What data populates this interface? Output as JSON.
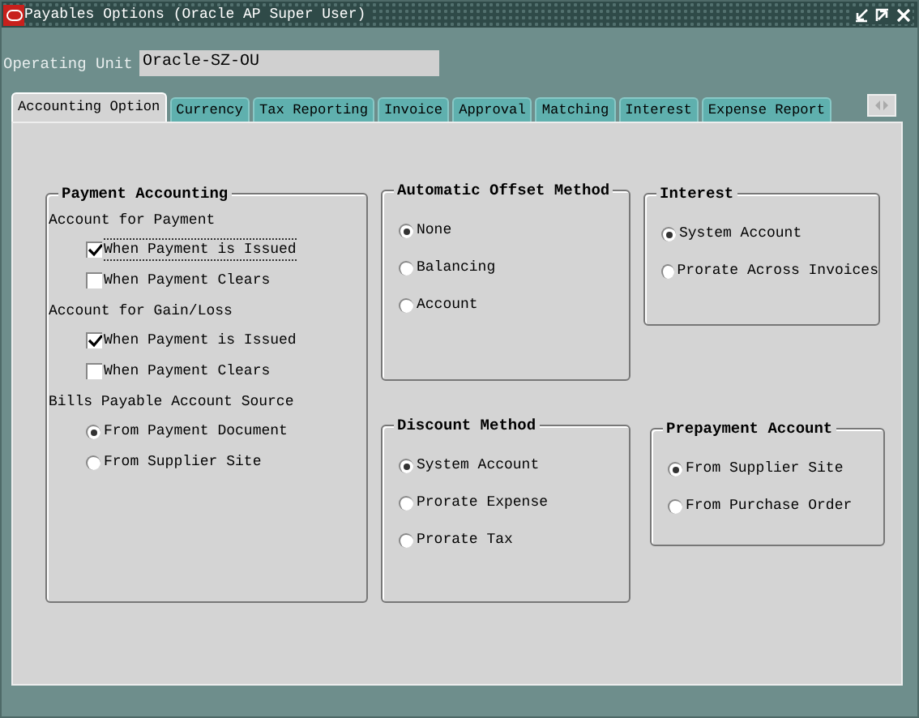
{
  "window": {
    "title": "Payables Options (Oracle AP Super User)"
  },
  "operating_unit": {
    "label": "Operating Unit",
    "value": "Oracle-SZ-OU"
  },
  "tabs": [
    {
      "label": "Accounting Option",
      "selected": true
    },
    {
      "label": "Currency",
      "selected": false
    },
    {
      "label": "Tax Reporting",
      "selected": false
    },
    {
      "label": "Invoice",
      "selected": false
    },
    {
      "label": "Approval",
      "selected": false
    },
    {
      "label": "Matching",
      "selected": false
    },
    {
      "label": "Interest",
      "selected": false
    },
    {
      "label": "Expense Report",
      "selected": false
    }
  ],
  "columns": [
    [
      {
        "title": "Payment Accounting",
        "items": [
          {
            "kind": "label",
            "text": "Account for Payment"
          },
          {
            "kind": "checkbox",
            "text": "When Payment is Issued",
            "checked": true,
            "focused": true
          },
          {
            "kind": "checkbox",
            "text": "When Payment Clears",
            "checked": false,
            "focused": false
          },
          {
            "kind": "label",
            "text": "Account for Gain/Loss"
          },
          {
            "kind": "checkbox",
            "text": "When Payment is Issued",
            "checked": true,
            "focused": false
          },
          {
            "kind": "checkbox",
            "text": "When Payment Clears",
            "checked": false,
            "focused": false
          },
          {
            "kind": "label",
            "text": "Bills Payable Account Source"
          },
          {
            "kind": "radio",
            "text": "From Payment Document",
            "selected": true
          },
          {
            "kind": "radio",
            "text": "From Supplier Site",
            "selected": false
          }
        ]
      }
    ],
    [
      {
        "title": "Automatic Offset Method",
        "items": [
          {
            "kind": "radio",
            "text": "None",
            "selected": true
          },
          {
            "kind": "radio",
            "text": "Balancing",
            "selected": false
          },
          {
            "kind": "radio",
            "text": "Account",
            "selected": false
          }
        ]
      },
      {
        "title": "Discount Method",
        "items": [
          {
            "kind": "radio",
            "text": "System Account",
            "selected": true
          },
          {
            "kind": "radio",
            "text": "Prorate Expense",
            "selected": false
          },
          {
            "kind": "radio",
            "text": "Prorate Tax",
            "selected": false
          }
        ]
      }
    ],
    [
      {
        "title": "Interest",
        "items": [
          {
            "kind": "radio",
            "text": "System Account",
            "selected": true
          },
          {
            "kind": "radio",
            "text": "Prorate Across Invoices",
            "selected": false
          }
        ]
      },
      {
        "title": "Prepayment Account",
        "items": [
          {
            "kind": "radio",
            "text": "From Supplier Site",
            "selected": true
          },
          {
            "kind": "radio",
            "text": "From Purchase Order",
            "selected": false
          }
        ]
      }
    ]
  ]
}
